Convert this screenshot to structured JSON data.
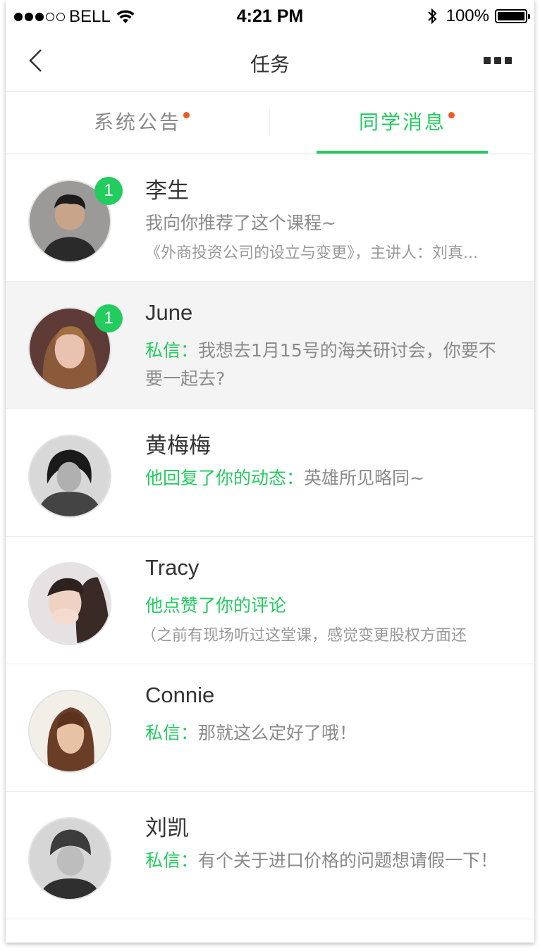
{
  "status": {
    "carrier": "BELL",
    "time": "4:21 PM",
    "battery": "100%"
  },
  "nav": {
    "title": "任务"
  },
  "tabs": [
    {
      "label": "系统公告"
    },
    {
      "label": "同学消息"
    }
  ],
  "messages": [
    {
      "name": "李生",
      "badge": "1",
      "line1": "我向你推荐了这个课程~",
      "line2": "《外商投资公司的设立与变更》，主讲人：刘真..."
    },
    {
      "name": "June",
      "badge": "1",
      "prefix": "私信：",
      "text": "我想去1月15号的海关研讨会，你要不要一起去?"
    },
    {
      "name": "黄梅梅",
      "prefix": "他回复了你的动态：",
      "text": "英雄所见略同~"
    },
    {
      "name": "Tracy",
      "prefix": "他点赞了你的评论",
      "line2": "（之前有现场听过这堂课，感觉变更股权方面还"
    },
    {
      "name": "Connie",
      "prefix": "私信：",
      "text": "那就这么定好了哦！"
    },
    {
      "name": "刘凯",
      "prefix": "私信：",
      "text": "有个关于进口价格的问题想请假一下！"
    }
  ],
  "colors": {
    "accent": "#22cc5e",
    "tab_dot": "#f05a22",
    "highlight_row": "#f4f4f4"
  }
}
